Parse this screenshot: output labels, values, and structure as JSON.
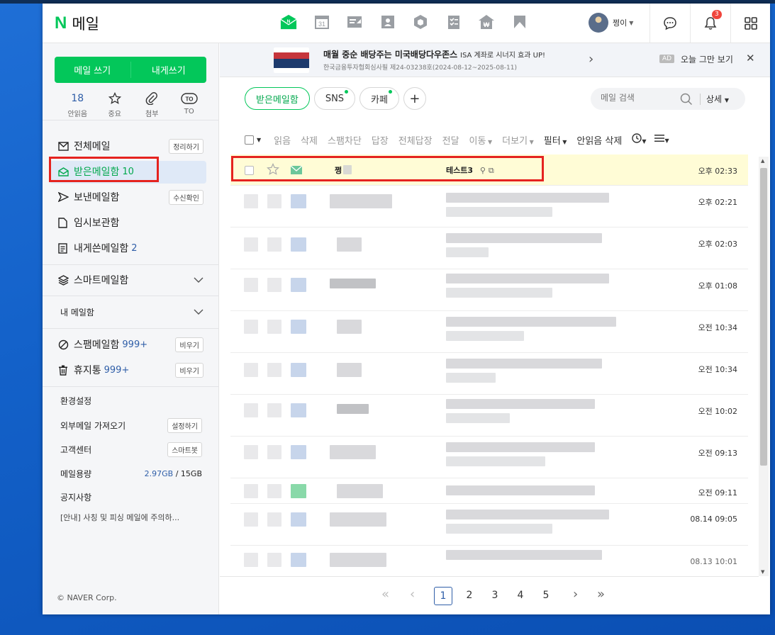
{
  "header": {
    "logo_letter": "N",
    "app_title": "메일",
    "username": "쩡이",
    "notification_count": "3"
  },
  "sidebar": {
    "compose_label": "메일 쓰기",
    "self_compose_label": "내게쓰기",
    "stats": [
      {
        "value": "18",
        "label": "안읽음"
      },
      {
        "label": "중요"
      },
      {
        "label": "첨부"
      },
      {
        "label": "TO"
      }
    ],
    "folders": [
      {
        "label": "전체메일",
        "button": "정리하기"
      },
      {
        "label": "받은메일함",
        "count": "10"
      },
      {
        "label": "보낸메일함",
        "button": "수신확인"
      },
      {
        "label": "임시보관함"
      },
      {
        "label": "내게쓴메일함",
        "count": "2"
      }
    ],
    "smart_mailbox": "스마트메일함",
    "my_mailbox": "내 메일함",
    "spam": {
      "label": "스팸메일함",
      "count": "999+",
      "button": "비우기"
    },
    "trash": {
      "label": "휴지통",
      "count": "999+",
      "button": "비우기"
    },
    "settings": "환경설정",
    "external": {
      "label": "외부메일 가져오기",
      "button": "설정하기"
    },
    "support": {
      "label": "고객센터",
      "button": "스마트봇"
    },
    "quota": {
      "label": "메일용량",
      "used": "2.97GB",
      "total": "/ 15GB"
    },
    "notice": "공지사항",
    "notice_item": "[안내] 사칭 및 피싱 메일에 주의하...",
    "copyright": "© NAVER Corp."
  },
  "ad": {
    "headline": "매월 중순 배당주는 미국배당다우존스",
    "sub": "ISA 계좌로 시너지 효과 UP!",
    "disclaimer": "한국금융투자협회심사필 제24-03238호(2024-08-12~2025-08-11)",
    "tag": "AD",
    "hide_today": "오늘 그만 보기"
  },
  "tabs": [
    {
      "label": "받은메일함"
    },
    {
      "label": "SNS"
    },
    {
      "label": "카페"
    }
  ],
  "search": {
    "placeholder": "메일 검색",
    "detail": "상세"
  },
  "toolbar": [
    "읽음",
    "삭제",
    "스팸차단",
    "답장",
    "전체답장",
    "전달",
    "이동",
    "더보기",
    "필터",
    "안읽음 삭제"
  ],
  "mails": [
    {
      "sender": "쩡",
      "subject": "테스트3",
      "time": "오후 02:33"
    },
    {
      "time": "오후 02:21"
    },
    {
      "time": "오후 02:03"
    },
    {
      "time": "오후 01:08"
    },
    {
      "time": "오전 10:34"
    },
    {
      "time": "오전 10:34"
    },
    {
      "time": "오전 10:02"
    },
    {
      "time": "오전 09:13"
    },
    {
      "time": "오전 09:11"
    },
    {
      "time": "08.14 09:05"
    },
    {
      "time": "08.13 10:01"
    }
  ],
  "pagination": [
    "1",
    "2",
    "3",
    "4",
    "5"
  ],
  "colors": {
    "brand": "#03c75a",
    "highlight": "#e5231f",
    "link": "#2f5ea8"
  }
}
